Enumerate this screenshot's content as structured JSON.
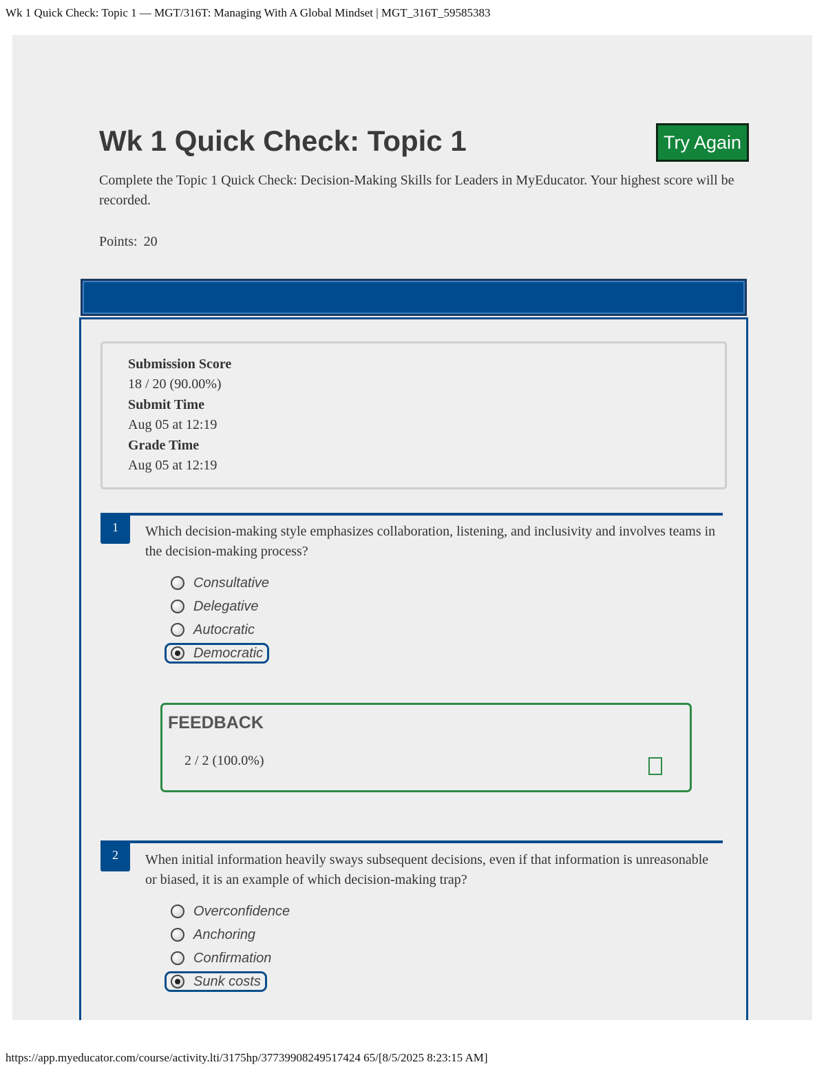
{
  "print": {
    "header": "Wk 1 Quick Check: Topic 1 — MGT/316T: Managing With A Global Mindset | MGT_316T_59585383",
    "footer": "https://app.myeducator.com/course/activity.lti/3175hp/37739908249517424 65/[8/5/2025 8:23:15 AM]"
  },
  "assignment": {
    "title": "Wk 1 Quick Check: Topic 1",
    "try_again_label": "Try Again",
    "description": "Complete the Topic 1 Quick Check: Decision-Making Skills for Leaders in MyEducator. Your highest score will be recorded.",
    "points_label": "Points:",
    "points_value": "20"
  },
  "submission": {
    "score_label": "Submission Score",
    "score_value": "18 / 20 (90.00%)",
    "submit_time_label": "Submit Time",
    "submit_time_value": "Aug 05 at 12:19",
    "grade_time_label": "Grade Time",
    "grade_time_value": "Aug 05 at 12:19"
  },
  "questions": [
    {
      "number": "1",
      "text": "Which decision-making style emphasizes collaboration, listening, and inclusivity and involves teams in the decision-making process?",
      "options": [
        "Consultative",
        "Delegative",
        "Autocratic",
        "Democratic"
      ],
      "selected": "Democratic",
      "feedback": {
        "title": "FEEDBACK",
        "score": "2 / 2  (100.0%)",
        "status_icon": "check-icon"
      }
    },
    {
      "number": "2",
      "text": "When initial information heavily sways subsequent decisions, even if that information is unreasonable or biased, it is an example of which decision-making trap?",
      "options": [
        "Overconfidence",
        "Anchoring",
        "Confirmation",
        "Sunk costs"
      ],
      "selected": "Sunk costs"
    }
  ],
  "colors": {
    "panel_blue": "#004b8d",
    "try_again_green": "#12853b",
    "feedback_border": "#2e8b46",
    "page_background": "#eeeeee"
  }
}
